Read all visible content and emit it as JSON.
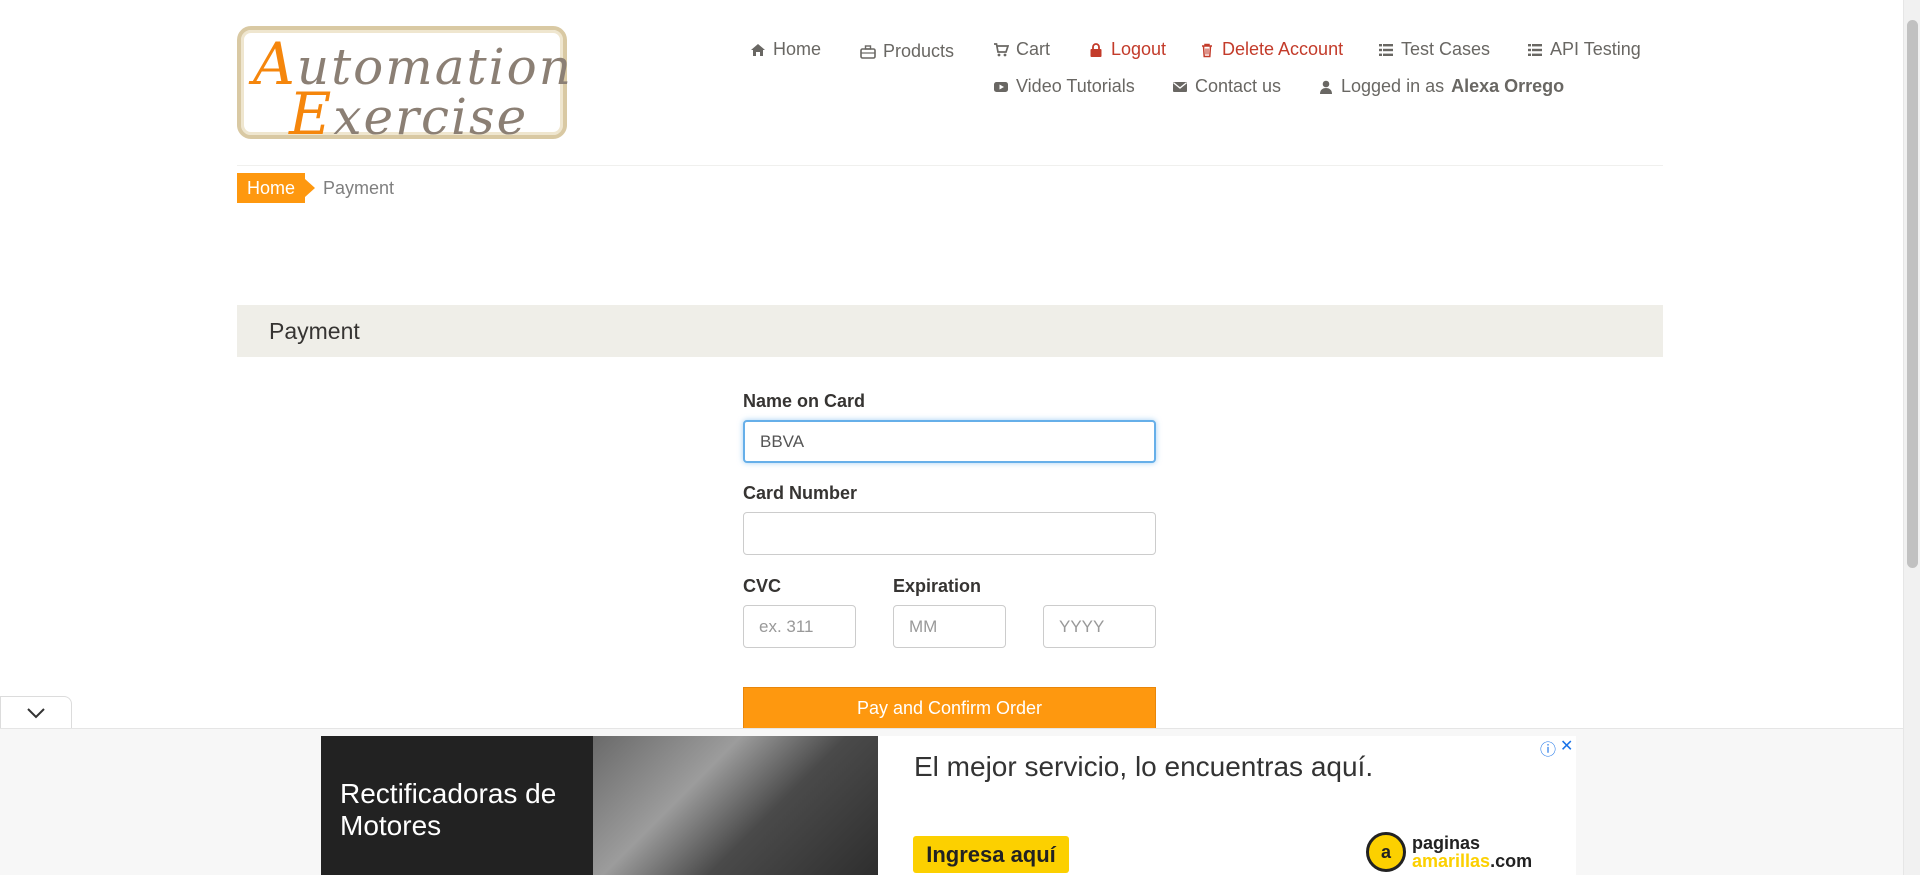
{
  "logo": {
    "line1_cap": "A",
    "line1_rest": "utomation",
    "line2_cap": "E",
    "line2_rest": "xercise"
  },
  "nav": {
    "home": "Home",
    "products": "Products",
    "cart": "Cart",
    "logout": "Logout",
    "delete_account": "Delete Account",
    "test_cases": "Test Cases",
    "api_testing": "API Testing",
    "video_tutorials": "Video Tutorials",
    "contact_us": "Contact us",
    "logged_in_prefix": "Logged in as",
    "logged_in_user": "Alexa Orrego"
  },
  "breadcrumb": {
    "home": "Home",
    "current": "Payment"
  },
  "section": {
    "title": "Payment"
  },
  "form": {
    "name_label": "Name on Card",
    "name_value": "BBVA",
    "card_number_label": "Card Number",
    "card_number_value": "",
    "cvc_label": "CVC",
    "cvc_placeholder": "ex. 311",
    "expiration_label": "Expiration",
    "month_placeholder": "MM",
    "year_placeholder": "YYYY",
    "submit_label": "Pay and Confirm Order"
  },
  "ad": {
    "dark_title": "Rectificadoras de Motores",
    "headline": "El mejor servicio, lo encuentras aquí.",
    "cta": "Ingresa aquí",
    "brand_line1": "paginas",
    "brand_line2": "amarillas",
    "brand_suffix": ".com",
    "info_icon": "ⓘ",
    "close_icon": "✕"
  },
  "colors": {
    "accent": "#fe980f",
    "danger": "#c33b2a",
    "band": "#efeee8"
  }
}
